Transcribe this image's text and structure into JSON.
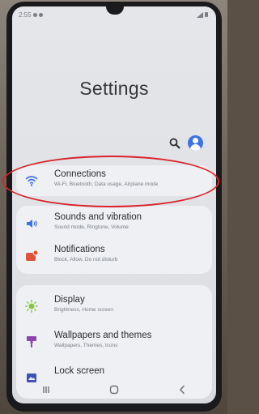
{
  "status_bar": {
    "time": "2:55"
  },
  "page": {
    "title": "Settings"
  },
  "settings_items": [
    {
      "id": "connections",
      "label": "Connections",
      "subtitle": "Wi-Fi, Bluetooth, Data usage, Airplane mode",
      "icon": "wifi-icon",
      "icon_color": "#3c72e6"
    },
    {
      "id": "sounds",
      "label": "Sounds and vibration",
      "subtitle": "Sound mode, Ringtone, Volume",
      "icon": "speaker-icon",
      "icon_color": "#3c72e6"
    },
    {
      "id": "notifications",
      "label": "Notifications",
      "subtitle": "Block, Allow, Do not disturb",
      "icon": "notification-icon",
      "icon_color": "#e0533b"
    },
    {
      "id": "display",
      "label": "Display",
      "subtitle": "Brightness, Home screen",
      "icon": "sun-icon",
      "icon_color": "#8bc34a"
    },
    {
      "id": "wallpapers",
      "label": "Wallpapers and themes",
      "subtitle": "Wallpapers, Themes, Icons",
      "icon": "brush-icon",
      "icon_color": "#8e44ad"
    },
    {
      "id": "lockscreen",
      "label": "Lock screen",
      "subtitle": "",
      "icon": "lock-screen-icon",
      "icon_color": "#3f51b5"
    }
  ],
  "highlight_color": "#d8242c",
  "nav": {
    "recent": "recent-apps-icon",
    "home": "home-icon",
    "back": "back-icon"
  }
}
